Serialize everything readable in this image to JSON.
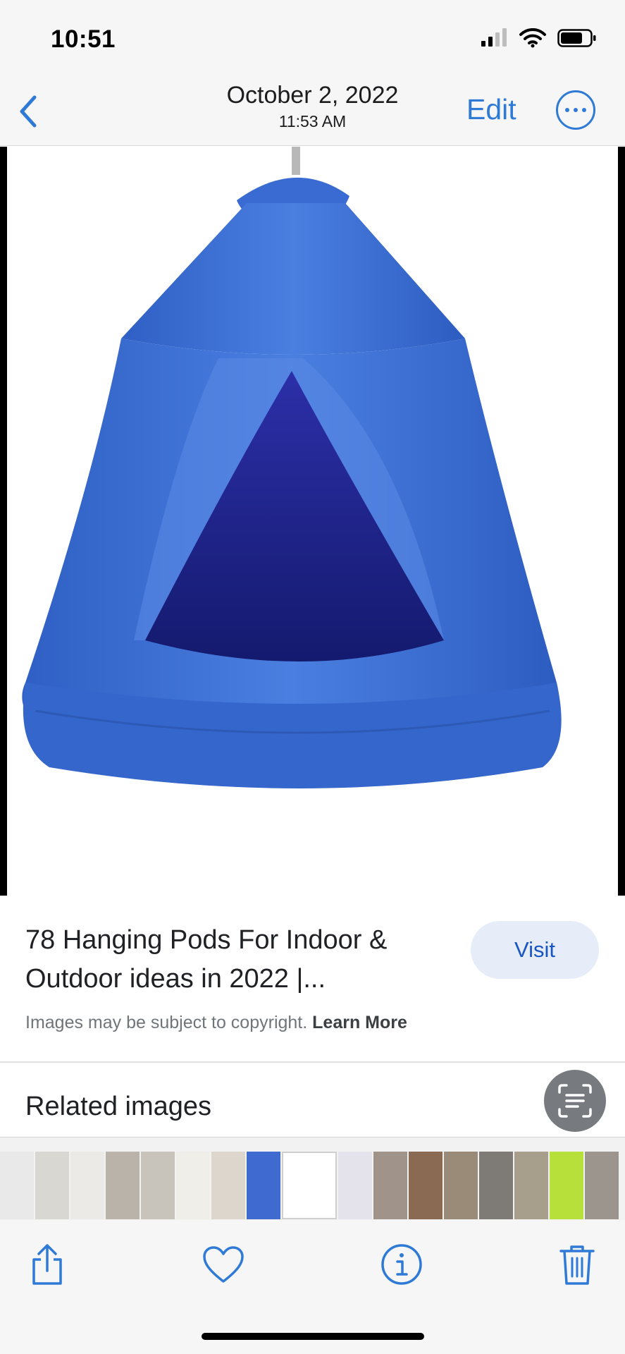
{
  "status_bar": {
    "time": "10:51"
  },
  "nav": {
    "date": "October 2, 2022",
    "time": "11:53 AM",
    "edit_label": "Edit"
  },
  "photo": {
    "subject": "hanging-pod-tent-image"
  },
  "result": {
    "title": "78 Hanging Pods For Indoor & Outdoor ideas in 2022 |...",
    "visit_label": "Visit",
    "copyright_text": "Images may be subject to copyright.",
    "learn_more": "Learn More"
  },
  "related": {
    "title": "Related images"
  },
  "filmstrip": {
    "thumb_count": 17
  },
  "toolbar": {
    "share": "share-icon",
    "favorite": "heart-icon",
    "info": "info-icon",
    "delete": "trash-icon"
  },
  "colors": {
    "accent": "#2f7ad6",
    "visit_bg": "#e6edf9",
    "tent_blue": "#3a6fd0",
    "tent_inner": "#1a1f8a"
  }
}
